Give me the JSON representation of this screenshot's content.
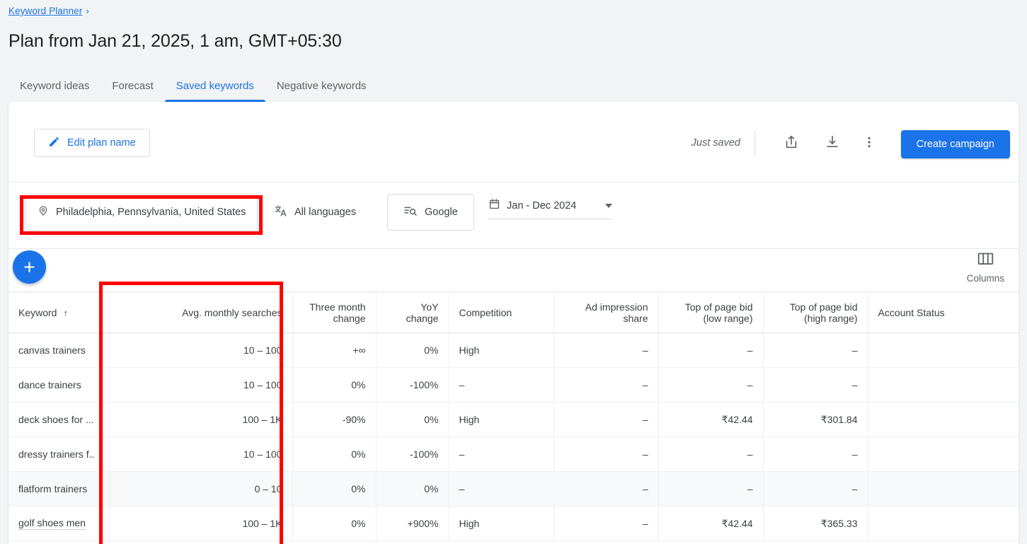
{
  "breadcrumb": {
    "link": "Keyword Planner",
    "chevron": "›"
  },
  "page_title": "Plan from Jan 21, 2025, 1 am, GMT+05:30",
  "tabs": [
    {
      "label": "Keyword ideas",
      "active": false
    },
    {
      "label": "Forecast",
      "active": false
    },
    {
      "label": "Saved keywords",
      "active": true
    },
    {
      "label": "Negative keywords",
      "active": false
    }
  ],
  "action_bar": {
    "edit_plan_label": "Edit plan name",
    "save_status": "Just saved",
    "share_icon": "share-icon",
    "download_icon": "download-icon",
    "more_icon": "more-vert-icon",
    "create_campaign_label": "Create campaign"
  },
  "filters": {
    "location": "Philadelphia, Pennsylvania, United States",
    "language": "All languages",
    "network": "Google",
    "date_range": "Jan - Dec 2024"
  },
  "table_tools": {
    "add_label": "+",
    "columns_label": "Columns"
  },
  "table": {
    "columns": [
      {
        "label": "Keyword",
        "align": "left",
        "sort": "↑"
      },
      {
        "label": "Avg. monthly searches",
        "align": "right"
      },
      {
        "label": "Three month change",
        "align": "right"
      },
      {
        "label": "YoY change",
        "align": "right"
      },
      {
        "label": "Competition",
        "align": "left"
      },
      {
        "label": "Ad impression share",
        "align": "right"
      },
      {
        "label": "Top of page bid (low range)",
        "align": "right"
      },
      {
        "label": "Top of page bid (high range)",
        "align": "right"
      },
      {
        "label": "Account Status",
        "align": "left"
      }
    ],
    "rows": [
      {
        "keyword": "canvas trainers",
        "hinted": false,
        "alt": false,
        "avg_monthly_searches": "10 – 100",
        "three_month_change": "+∞",
        "yoy_change": "0%",
        "competition": "High",
        "ad_impression_share": "–",
        "bid_low": "–",
        "bid_high": "–",
        "account_status": ""
      },
      {
        "keyword": "dance trainers",
        "hinted": false,
        "alt": false,
        "avg_monthly_searches": "10 – 100",
        "three_month_change": "0%",
        "yoy_change": "-100%",
        "competition": "–",
        "ad_impression_share": "–",
        "bid_low": "–",
        "bid_high": "–",
        "account_status": ""
      },
      {
        "keyword": "deck shoes for ...",
        "hinted": false,
        "alt": false,
        "avg_monthly_searches": "100 – 1K",
        "three_month_change": "-90%",
        "yoy_change": "0%",
        "competition": "High",
        "ad_impression_share": "–",
        "bid_low": "₹42.44",
        "bid_high": "₹301.84",
        "account_status": ""
      },
      {
        "keyword": "dressy trainers f..",
        "hinted": false,
        "alt": false,
        "avg_monthly_searches": "10 – 100",
        "three_month_change": "0%",
        "yoy_change": "-100%",
        "competition": "–",
        "ad_impression_share": "–",
        "bid_low": "–",
        "bid_high": "–",
        "account_status": ""
      },
      {
        "keyword": "flatform trainers",
        "hinted": false,
        "alt": true,
        "avg_monthly_searches": "0 – 10",
        "three_month_change": "0%",
        "yoy_change": "0%",
        "competition": "–",
        "ad_impression_share": "–",
        "bid_low": "–",
        "bid_high": "–",
        "account_status": ""
      },
      {
        "keyword": "golf shoes men",
        "hinted": true,
        "alt": false,
        "avg_monthly_searches": "100 – 1K",
        "three_month_change": "0%",
        "yoy_change": "+900%",
        "competition": "High",
        "ad_impression_share": "–",
        "bid_low": "₹42.44",
        "bid_high": "₹365.33",
        "account_status": ""
      }
    ]
  },
  "annotations": [
    {
      "name": "location-filter-highlight",
      "color": "#ff0000"
    },
    {
      "name": "avg-monthly-searches-column-highlight",
      "color": "#ff0000"
    }
  ],
  "colors": {
    "accent_blue": "#1a73e8",
    "text_primary": "#202124",
    "text_secondary": "#5f6368",
    "page_bg": "#f1f3f4",
    "annotation_red": "#ff0000"
  }
}
